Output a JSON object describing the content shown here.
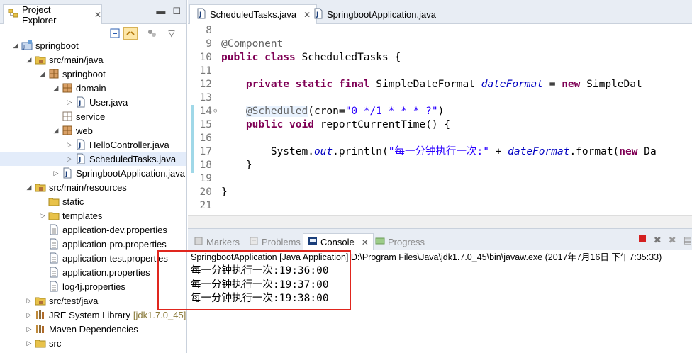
{
  "project_explorer": {
    "tab_label": "Project Explorer",
    "tree": [
      {
        "label": "springboot",
        "depth": 0,
        "icon": "project-icon",
        "expanded": true
      },
      {
        "label": "src/main/java",
        "depth": 1,
        "icon": "source-folder-icon",
        "expanded": true
      },
      {
        "label": "springboot",
        "depth": 2,
        "icon": "package-icon",
        "expanded": true
      },
      {
        "label": "domain",
        "depth": 3,
        "icon": "package-icon",
        "expanded": true
      },
      {
        "label": "User.java",
        "depth": 4,
        "icon": "java-file-icon",
        "expanded": false
      },
      {
        "label": "service",
        "depth": 3,
        "icon": "package-empty-icon",
        "leaf": true
      },
      {
        "label": "web",
        "depth": 3,
        "icon": "package-icon",
        "expanded": true
      },
      {
        "label": "HelloController.java",
        "depth": 4,
        "icon": "java-file-icon",
        "expanded": false
      },
      {
        "label": "ScheduledTasks.java",
        "depth": 4,
        "icon": "java-file-icon",
        "expanded": false,
        "selected": true
      },
      {
        "label": "SpringbootApplication.java",
        "depth": 3,
        "icon": "java-file-icon",
        "expanded": false
      },
      {
        "label": "src/main/resources",
        "depth": 1,
        "icon": "source-folder-icon",
        "expanded": true
      },
      {
        "label": "static",
        "depth": 2,
        "icon": "folder-icon",
        "leaf": true
      },
      {
        "label": "templates",
        "depth": 2,
        "icon": "folder-icon",
        "expanded": false
      },
      {
        "label": "application-dev.properties",
        "depth": 2,
        "icon": "properties-file-icon",
        "leaf": true
      },
      {
        "label": "application-pro.properties",
        "depth": 2,
        "icon": "properties-file-icon",
        "leaf": true
      },
      {
        "label": "application-test.properties",
        "depth": 2,
        "icon": "properties-file-icon",
        "leaf": true
      },
      {
        "label": "application.properties",
        "depth": 2,
        "icon": "properties-file-icon",
        "leaf": true
      },
      {
        "label": "log4j.properties",
        "depth": 2,
        "icon": "properties-file-icon",
        "leaf": true
      },
      {
        "label": "src/test/java",
        "depth": 1,
        "icon": "source-folder-icon",
        "expanded": false
      },
      {
        "label": "JRE System Library",
        "suffix": "[jdk1.7.0_45]",
        "depth": 1,
        "icon": "library-icon",
        "expanded": false
      },
      {
        "label": "Maven Dependencies",
        "depth": 1,
        "icon": "library-icon",
        "expanded": false
      },
      {
        "label": "src",
        "depth": 1,
        "icon": "folder-icon",
        "expanded": false
      }
    ]
  },
  "editor": {
    "tabs": [
      {
        "label": "ScheduledTasks.java",
        "active": true
      },
      {
        "label": "SpringbootApplication.java",
        "active": false
      }
    ],
    "lines": [
      {
        "n": "8",
        "tokens": []
      },
      {
        "n": "9",
        "tokens": [
          {
            "t": "@Component",
            "c": "ann"
          }
        ]
      },
      {
        "n": "10",
        "tokens": [
          {
            "t": "public",
            "c": "kw"
          },
          {
            "t": " "
          },
          {
            "t": "class",
            "c": "kw"
          },
          {
            "t": " ScheduledTasks {"
          }
        ]
      },
      {
        "n": "11",
        "tokens": []
      },
      {
        "n": "12",
        "tokens": [
          {
            "t": "    "
          },
          {
            "t": "private",
            "c": "kw"
          },
          {
            "t": " "
          },
          {
            "t": "static",
            "c": "kw"
          },
          {
            "t": " "
          },
          {
            "t": "final",
            "c": "kw"
          },
          {
            "t": " SimpleDateFormat "
          },
          {
            "t": "dateFormat",
            "c": "fld"
          },
          {
            "t": " = "
          },
          {
            "t": "new",
            "c": "kw"
          },
          {
            "t": " SimpleDat"
          }
        ]
      },
      {
        "n": "13",
        "tokens": []
      },
      {
        "n": "14",
        "tokens": [
          {
            "t": "    "
          },
          {
            "t": "@Scheduled",
            "c": "ann"
          },
          {
            "t": "(cron="
          },
          {
            "t": "\"0 */1 * * * ?\"",
            "c": "str"
          },
          {
            "t": ")"
          }
        ],
        "fold": true
      },
      {
        "n": "15",
        "tokens": [
          {
            "t": "    "
          },
          {
            "t": "public",
            "c": "kw"
          },
          {
            "t": " "
          },
          {
            "t": "void",
            "c": "kw"
          },
          {
            "t": " reportCurrentTime() {"
          }
        ]
      },
      {
        "n": "16",
        "tokens": []
      },
      {
        "n": "17",
        "tokens": [
          {
            "t": "        System."
          },
          {
            "t": "out",
            "c": "fld"
          },
          {
            "t": ".println("
          },
          {
            "t": "\"每一分钟执行一次:\"",
            "c": "str"
          },
          {
            "t": " + "
          },
          {
            "t": "dateFormat",
            "c": "fld"
          },
          {
            "t": ".format("
          },
          {
            "t": "new",
            "c": "kw"
          },
          {
            "t": " Da"
          }
        ]
      },
      {
        "n": "18",
        "tokens": [
          {
            "t": "    }"
          }
        ]
      },
      {
        "n": "19",
        "tokens": []
      },
      {
        "n": "20",
        "tokens": [
          {
            "t": "}"
          }
        ]
      },
      {
        "n": "21",
        "tokens": []
      }
    ]
  },
  "console": {
    "tabs": [
      {
        "label": "Markers",
        "icon": "markers-icon",
        "active": false
      },
      {
        "label": "Problems",
        "icon": "problems-icon",
        "active": false
      },
      {
        "label": "Console",
        "icon": "console-icon",
        "active": true
      },
      {
        "label": "Progress",
        "icon": "progress-icon",
        "active": false
      }
    ],
    "description": "SpringbootApplication [Java Application] D:\\Program Files\\Java\\jdk1.7.0_45\\bin\\javaw.exe (2017年7月16日 下午7:35:33)",
    "output": [
      "每一分钟执行一次:19:36:00",
      "每一分钟执行一次:19:37:00",
      "每一分钟执行一次:19:38:00"
    ]
  },
  "colors": {
    "highlight_box": "#e0261e",
    "keyword": "#7f0055",
    "string": "#2a00ff",
    "field": "#0000c0",
    "annotation": "#646464"
  }
}
